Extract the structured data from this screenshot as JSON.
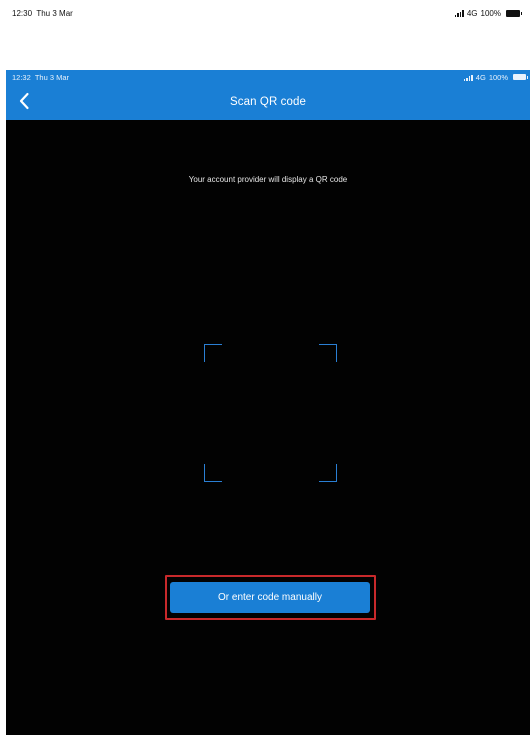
{
  "outer_status": {
    "time": "12:30",
    "date": "Thu 3 Mar",
    "network": "4G",
    "battery": "100%"
  },
  "inner_status": {
    "time": "12:32",
    "date": "Thu 3 Mar",
    "network": "4G",
    "battery": "100%"
  },
  "navbar": {
    "title": "Scan QR code",
    "back_icon": "chevron-left-icon"
  },
  "scan": {
    "instruction": "Your account provider will display a QR code"
  },
  "manual_entry": {
    "label": "Or enter code manually"
  },
  "colors": {
    "accent": "#1a7fd5",
    "highlight": "#c8292b",
    "background": "#020202"
  }
}
